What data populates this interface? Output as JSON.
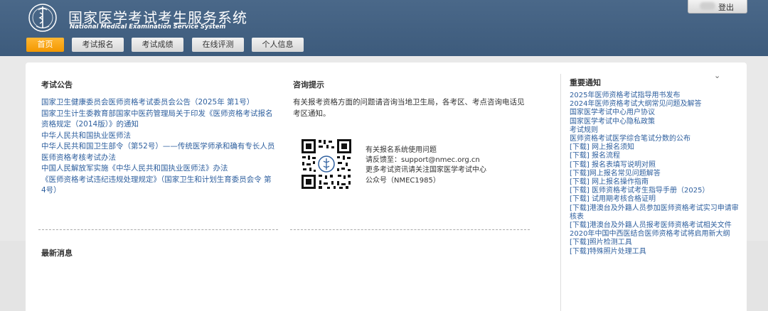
{
  "header": {
    "title_cn": "国家医学考试考生服务系统",
    "title_en": "National Medical Examination Service System",
    "emblem_icon": "caduceus-seal-icon",
    "logout_label": "登出"
  },
  "nav": {
    "active_color": "#f39800",
    "items": [
      {
        "label": "首页",
        "active": true
      },
      {
        "label": "考试报名"
      },
      {
        "label": "考试成绩"
      },
      {
        "label": "在线评测"
      },
      {
        "label": "个人信息"
      }
    ]
  },
  "exam_notices": {
    "title": "考试公告",
    "items": [
      "国家卫生健康委员会医师资格考试委员会公告（2025年 第1号）",
      "国家卫生计生委教育部国家中医药管理局关于印发《医师资格考试报名资格规定（2014版）》的通知",
      "中华人民共和国执业医师法",
      "中华人民共和国卫生部令（第52号）——传统医学师承和确有专长人员医师资格考核考试办法",
      "中国人民解放军实施《中华人民共和国执业医师法》办法",
      "《医师资格考试违纪违规处理规定》（国家卫生和计划生育委员会令 第4号）"
    ]
  },
  "consult": {
    "title": "咨询提示",
    "text": "有关报考资格方面的问题请咨询当地卫生局，各考区、考点咨询电话见考区通知。",
    "qr_icon": "qr-code-icon",
    "contact_lines": [
      "有关报名系统使用问题",
      "请反馈至：support@nmec.org.cn",
      "更多考试资讯请关注国家医学考试中心",
      "公众号（NMEC1985）"
    ]
  },
  "latest": {
    "title": "最新消息"
  },
  "important": {
    "title": "重要通知",
    "toggle_icon": "chevron-down-icon",
    "items": [
      "2025年医师资格考试指导用书发布",
      "2024年医师资格考试大纲常见问题及解答",
      "国家医学考试中心用户协议",
      "国家医学考试中心隐私政策",
      "考试规则",
      "医师资格考试医学综合笔试分数的公布",
      "[下载] 网上报名须知",
      "[下载] 报名流程",
      "[下载] 报名表填写说明对照",
      "[下载]网上报名常见问题解答",
      "[下载] 网上报名操作指南",
      "[下载] 医师资格考试考生指导手册（2025）",
      "[下载] 试用期考核合格证明",
      "[下载]港澳台及外籍人员参加医师资格考试实习申请审核表",
      "[下载]港澳台及外籍人员报考医师资格考试相关文件",
      "2020年中国中西医结合医师资格考试将启用新大纲",
      "[下载]照片检测工具",
      "[下载]特殊照片处理工具"
    ]
  }
}
